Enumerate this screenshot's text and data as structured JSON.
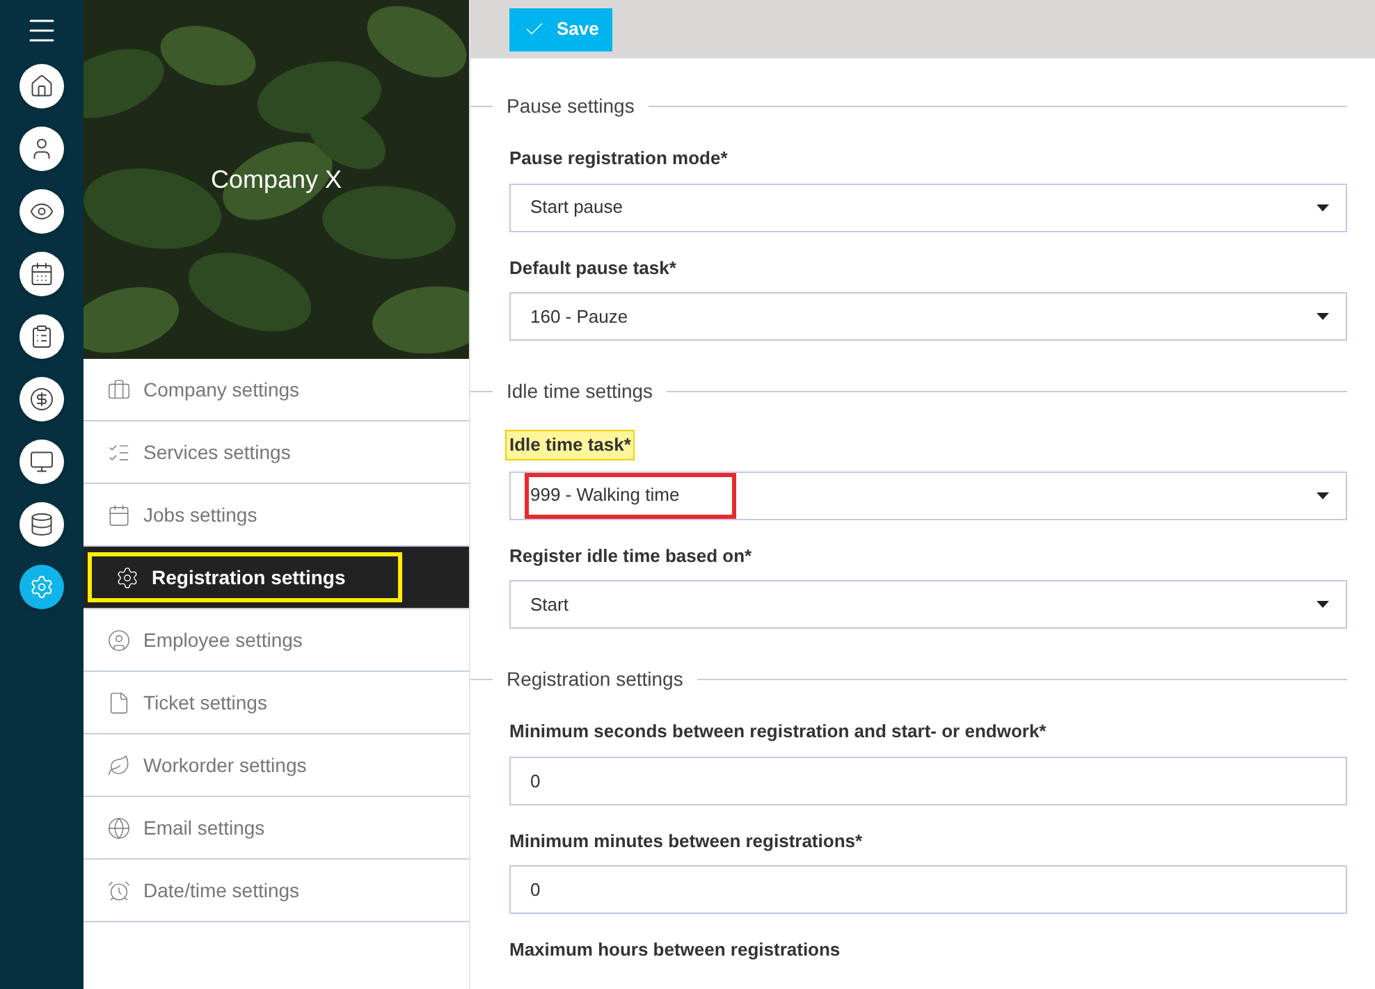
{
  "rail": {
    "items": [
      {
        "selected": false
      },
      {
        "selected": false
      },
      {
        "selected": false
      },
      {
        "selected": false
      },
      {
        "selected": false
      },
      {
        "selected": false
      },
      {
        "selected": false
      },
      {
        "selected": false
      },
      {
        "selected": true
      }
    ]
  },
  "company": {
    "name": "Company X"
  },
  "nav": [
    {
      "label": "Company settings",
      "selected": false,
      "highlighted": false
    },
    {
      "label": "Services settings",
      "selected": false,
      "highlighted": false
    },
    {
      "label": "Jobs settings",
      "selected": false,
      "highlighted": false
    },
    {
      "label": "Registration settings",
      "selected": true,
      "highlighted": true
    },
    {
      "label": "Employee settings",
      "selected": false,
      "highlighted": false
    },
    {
      "label": "Ticket settings",
      "selected": false,
      "highlighted": false
    },
    {
      "label": "Workorder settings",
      "selected": false,
      "highlighted": false
    },
    {
      "label": "Email settings",
      "selected": false,
      "highlighted": false
    },
    {
      "label": "Date/time settings",
      "selected": false,
      "highlighted": false
    }
  ],
  "toolbar": {
    "save": "Save"
  },
  "sections": [
    {
      "title": "Pause settings",
      "fields": [
        {
          "kind": "select",
          "label": "Pause registration mode*",
          "value": "Start pause",
          "label_highlighted": false,
          "value_outlined": false
        },
        {
          "kind": "select",
          "label": "Default pause task*",
          "value": "160 - Pauze",
          "label_highlighted": false,
          "value_outlined": false
        }
      ]
    },
    {
      "title": "Idle time settings",
      "fields": [
        {
          "kind": "select",
          "label": "Idle time task*",
          "value": "999 - Walking time",
          "label_highlighted": true,
          "value_outlined": true
        },
        {
          "kind": "select",
          "label": "Register idle time based on*",
          "value": "Start",
          "label_highlighted": false,
          "value_outlined": false
        }
      ]
    },
    {
      "title": "Registration settings",
      "fields": [
        {
          "kind": "input",
          "label": "Minimum seconds between registration and start- or endwork*",
          "value": "0",
          "label_highlighted": false
        },
        {
          "kind": "input",
          "label": "Minimum minutes between registrations*",
          "value": "0",
          "label_highlighted": false
        },
        {
          "kind": "label",
          "label": "Maximum hours between registrations",
          "label_highlighted": false
        }
      ]
    }
  ]
}
